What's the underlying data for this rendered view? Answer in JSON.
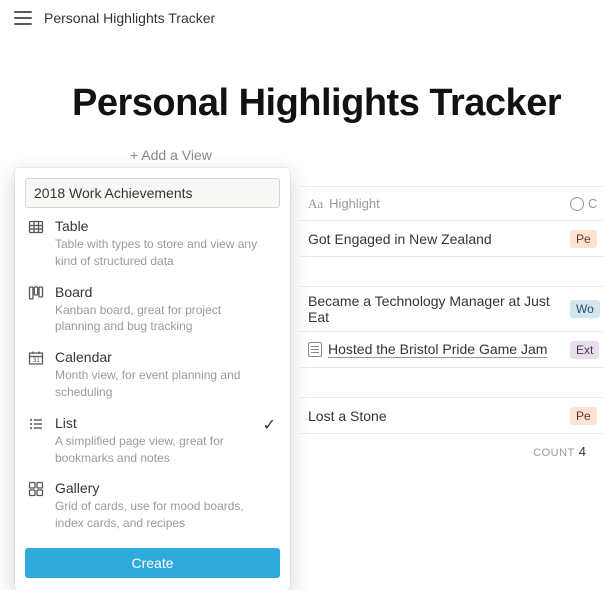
{
  "topbar": {
    "title": "Personal Highlights Tracker"
  },
  "page": {
    "title": "Personal Highlights Tracker"
  },
  "add_view_label": "+ Add a View",
  "table": {
    "header_highlight": "Highlight",
    "header_cat": "C",
    "rows": [
      {
        "title": "Got Engaged in New Zealand",
        "tag_label": "Pe",
        "tag_class": "pe",
        "icon": false,
        "underline": false
      },
      {
        "title": "Became a Technology Manager at Just Eat",
        "tag_label": "Wo",
        "tag_class": "wo",
        "icon": false,
        "underline": false
      },
      {
        "title": "Hosted the Bristol Pride Game Jam",
        "tag_label": "Ext",
        "tag_class": "ex",
        "icon": true,
        "underline": true
      },
      {
        "title": "Lost a Stone",
        "tag_label": "Pe",
        "tag_class": "pe",
        "icon": false,
        "underline": false
      }
    ],
    "count_label": "COUNT",
    "count_value": "4"
  },
  "popup": {
    "input_value": "2018 Work Achievements",
    "options": [
      {
        "key": "table",
        "name": "Table",
        "desc": "Table with types to store and view any kind of structured data",
        "selected": false
      },
      {
        "key": "board",
        "name": "Board",
        "desc": "Kanban board, great for project planning and bug tracking",
        "selected": false
      },
      {
        "key": "calendar",
        "name": "Calendar",
        "desc": "Month view, for event planning and scheduling",
        "selected": false
      },
      {
        "key": "list",
        "name": "List",
        "desc": "A simplified page view, great for bookmarks and notes",
        "selected": true
      },
      {
        "key": "gallery",
        "name": "Gallery",
        "desc": "Grid of cards, use for mood boards, index cards, and recipes",
        "selected": false
      }
    ],
    "create_label": "Create"
  }
}
